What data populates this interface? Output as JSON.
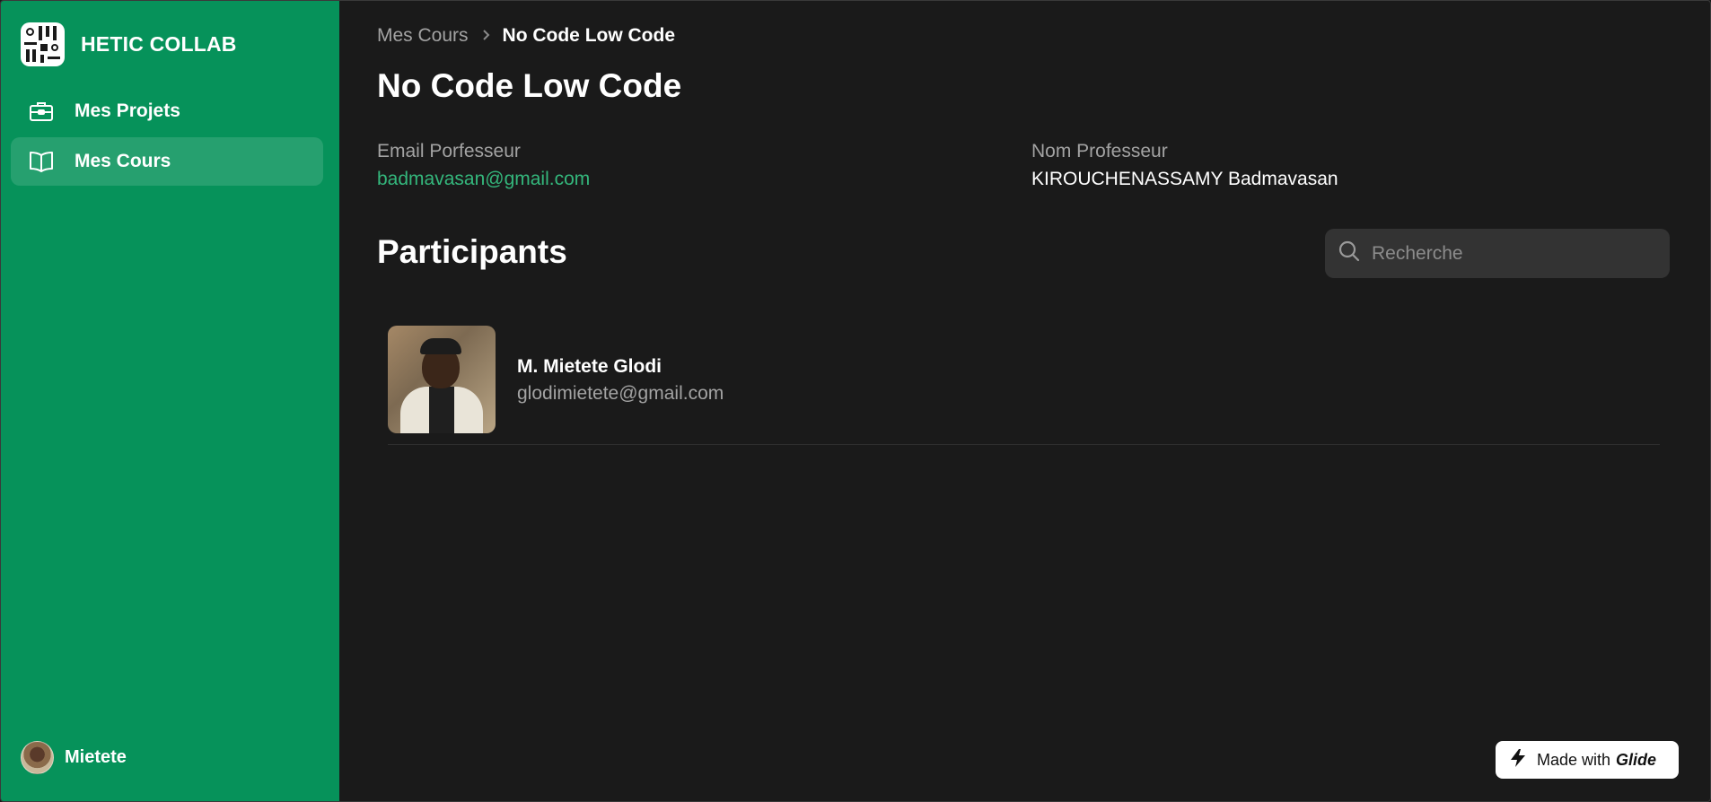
{
  "app": {
    "name": "HETIC COLLAB",
    "accent": "#06925a",
    "link_color": "#34b77c"
  },
  "sidebar": {
    "items": [
      {
        "label": "Mes Projets",
        "icon": "briefcase-icon",
        "active": false
      },
      {
        "label": "Mes Cours",
        "icon": "book-open-icon",
        "active": true
      }
    ],
    "user": {
      "name": "Mietete"
    }
  },
  "breadcrumb": {
    "parent": "Mes Cours",
    "current": "No Code Low Code"
  },
  "course": {
    "title": "No Code Low Code",
    "email_label": "Email Porfesseur",
    "email_value": "badmavasan@gmail.com",
    "name_label": "Nom Professeur",
    "name_value": "KIROUCHENASSAMY Badmavasan"
  },
  "participants": {
    "title": "Participants",
    "search_placeholder": "Recherche",
    "items": [
      {
        "name": "M. Mietete Glodi",
        "email": "glodimietete@gmail.com"
      }
    ]
  },
  "footer": {
    "badge_prefix": "Made with",
    "badge_brand": "Glide"
  }
}
